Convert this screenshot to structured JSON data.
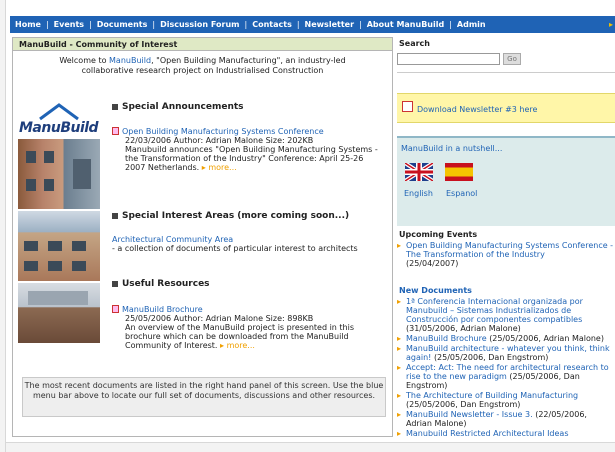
{
  "nav": {
    "items": [
      "Home",
      "Events",
      "Documents",
      "Discussion Forum",
      "Contacts",
      "Newsletter",
      "About ManuBuild",
      "Admin"
    ],
    "separator": "|"
  },
  "left": {
    "title": "ManuBuild - Community of Interest",
    "welcome_prefix": "Welcome to ",
    "welcome_link": "ManuBuild",
    "welcome_suffix": ", \"Open Building Manufacturing\", an industry-led collaborative research project on Industrialised Construction",
    "logo": "ManuBuild",
    "special_announcements": {
      "title": "Special Announcements",
      "doc_title": "Open Building Manufacturing Systems Conference",
      "meta": "22/03/2006   Author: Adrian Malone   Size: 202KB",
      "desc": "Manubuild announces \"Open Building Manufacturing Systems - the Transformation of the Industry\" Conference: April 25-26 2007 Netherlands.",
      "more": "more..."
    },
    "special_interest": {
      "title": "Special Interest Areas (more coming soon...)",
      "area_title": "Architectural Community Area",
      "area_desc": " - a collection of documents of particular interest to architects"
    },
    "useful_resources": {
      "title": "Useful Resources",
      "doc_title": "ManuBuild Brochure",
      "meta": "25/05/2006   Author: Adrian Malone   Size: 898KB",
      "desc": "An overview of the ManuBuild project is presented in this brochure which can be downloaded from the ManuBuild Community of Interest.",
      "more": "more..."
    },
    "footer_note": "The most recent documents are listed in the right hand panel of this screen. Use the blue menu bar above to locate our full set of documents, discussions and other resources."
  },
  "right": {
    "search_label": "Search",
    "go_label": "Go",
    "newsletter_link": "Download Newsletter #3 here",
    "nutshell_label": "ManuBuild in a nutshell...",
    "lang_english": "English",
    "lang_spanish": "Espanol",
    "upcoming_title": "Upcoming Events",
    "upcoming": [
      {
        "link": "Open Building Manufacturing Systems Conference - The Transformation of the Industry",
        "tail": "(25/04/2007)"
      }
    ],
    "new_docs_title": "New Documents",
    "new_docs": [
      {
        "link": "1ª Conferencia Internacional organizada por Manubuild – Sistemas Industrializados de Construcción por componentes compatibles",
        "tail": "(31/05/2006, Adrian Malone)"
      },
      {
        "link": "ManuBuild Brochure",
        "tail": "(25/05/2006, Adrian Malone)"
      },
      {
        "link": "ManuBuild architecture - whatever you think, think again!",
        "tail": "(25/05/2006, Dan Engstrom)"
      },
      {
        "link": "Accept: Act: The need for architectural research to rise to the new paradigm",
        "tail": "(25/05/2006, Dan Engstrom)"
      },
      {
        "link": "The Architecture of Building Manufacturing",
        "tail": "(25/05/2006, Dan Engstrom)"
      },
      {
        "link": "ManuBuild Newsletter - Issue 3.",
        "tail": "(22/05/2006, Adrian Malone)"
      },
      {
        "link": "Manubuild Restricted Architectural Ideas",
        "tail": ""
      }
    ]
  }
}
